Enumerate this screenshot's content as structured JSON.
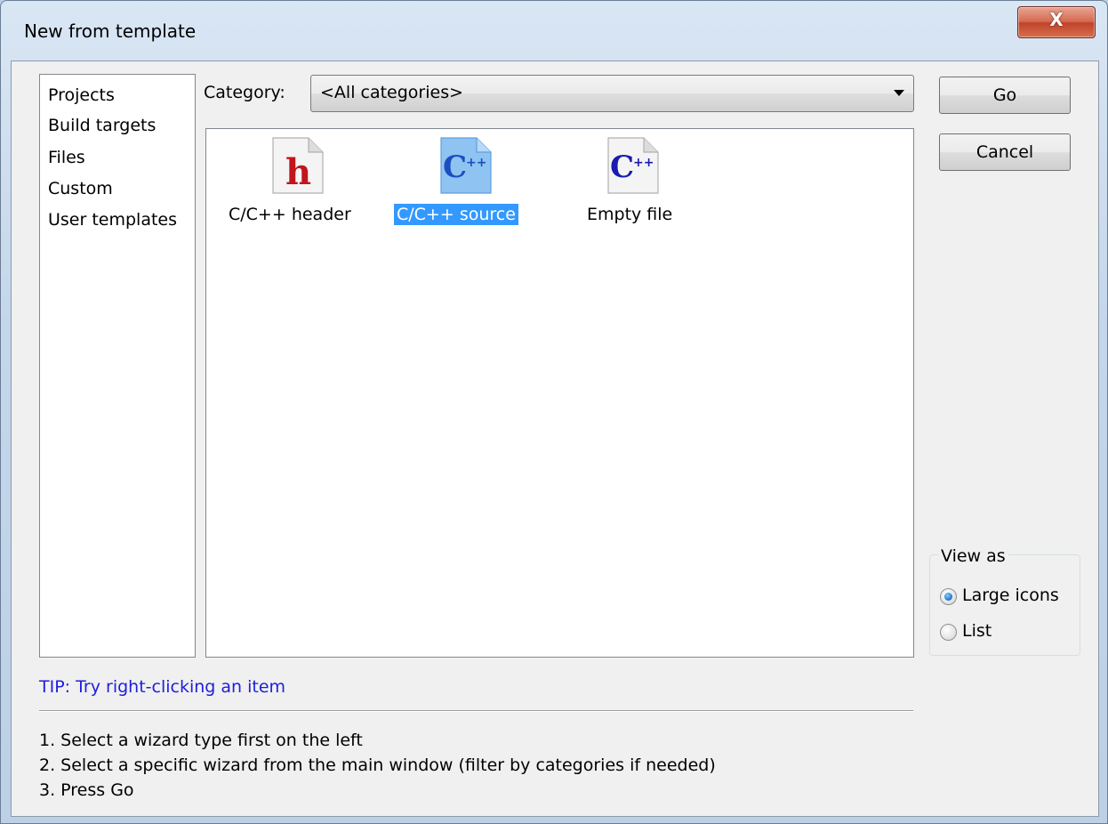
{
  "window": {
    "title": "New from template",
    "close_label": "X"
  },
  "sidebar": {
    "items": [
      {
        "label": "Projects"
      },
      {
        "label": "Build targets"
      },
      {
        "label": "Files"
      },
      {
        "label": "Custom"
      },
      {
        "label": "User templates"
      }
    ]
  },
  "category": {
    "label": "Category:",
    "selected": "<All categories>"
  },
  "templates": [
    {
      "label": "C/C++ header",
      "icon": "cpp-header-file-icon",
      "selected": false
    },
    {
      "label": "C/C++ source",
      "icon": "cpp-source-file-icon",
      "selected": true
    },
    {
      "label": "Empty file",
      "icon": "empty-file-icon",
      "selected": false
    }
  ],
  "buttons": {
    "go": "Go",
    "cancel": "Cancel"
  },
  "view_as": {
    "title": "View as",
    "options": [
      {
        "label": "Large icons",
        "checked": true
      },
      {
        "label": "List",
        "checked": false
      }
    ]
  },
  "tip": "TIP: Try right-clicking an item",
  "instructions": [
    "1. Select a wizard type first on the left",
    "2. Select a specific wizard from the main window (filter by categories if needed)",
    "3. Press Go"
  ],
  "colors": {
    "tip_text": "#1e1edc",
    "selection": "#3399ff",
    "cpp_logo": "#1b1bb0",
    "header_logo": "#c0161c"
  }
}
